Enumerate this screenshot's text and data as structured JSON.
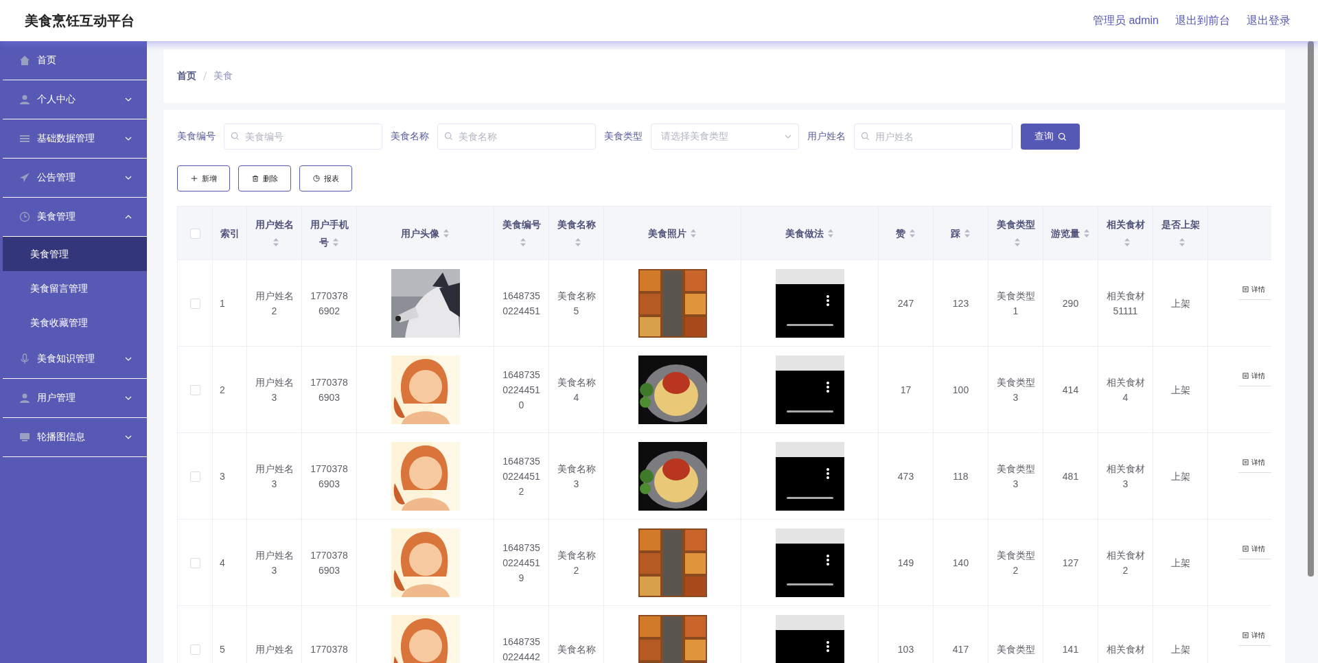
{
  "header": {
    "title": "美食烹饪互动平台",
    "links": [
      "管理员 admin",
      "退出到前台",
      "退出登录"
    ]
  },
  "sidebar": {
    "items": [
      {
        "label": "首页",
        "kind": "link"
      },
      {
        "label": "个人中心",
        "kind": "group",
        "expanded": false
      },
      {
        "label": "基础数据管理",
        "kind": "group",
        "expanded": false
      },
      {
        "label": "公告管理",
        "kind": "group",
        "expanded": false
      },
      {
        "label": "美食管理",
        "kind": "group",
        "expanded": true,
        "children": [
          {
            "label": "美食管理",
            "selected": true
          },
          {
            "label": "美食留言管理",
            "selected": false
          },
          {
            "label": "美食收藏管理",
            "selected": false
          }
        ]
      },
      {
        "label": "美食知识管理",
        "kind": "group",
        "expanded": false
      },
      {
        "label": "用户管理",
        "kind": "group",
        "expanded": false
      },
      {
        "label": "轮播图信息",
        "kind": "group",
        "expanded": false
      }
    ]
  },
  "breadcrumb": [
    "首页",
    "美食"
  ],
  "filters": [
    {
      "label": "美食编号",
      "placeholder": "美食编号",
      "kind": "input"
    },
    {
      "label": "美食名称",
      "placeholder": "美食名称",
      "kind": "input"
    },
    {
      "label": "美食类型",
      "placeholder": "请选择美食类型",
      "kind": "select"
    },
    {
      "label": "用户姓名",
      "placeholder": "用户姓名",
      "kind": "input"
    }
  ],
  "search_button": "查询",
  "actions": [
    "新增",
    "删除",
    "报表"
  ],
  "table": {
    "header_checked": false,
    "columns": [
      {
        "label": "索引",
        "sortable": false
      },
      {
        "label": "用户姓名",
        "sortable": true
      },
      {
        "label": "用户手机号",
        "sortable": true
      },
      {
        "label": "用户头像",
        "sortable": true
      },
      {
        "label": "美食编号",
        "sortable": true
      },
      {
        "label": "美食名称",
        "sortable": true
      },
      {
        "label": "美食照片",
        "sortable": true
      },
      {
        "label": "美食做法",
        "sortable": true
      },
      {
        "label": "赞",
        "sortable": true
      },
      {
        "label": "踩",
        "sortable": true
      },
      {
        "label": "美食类型",
        "sortable": true
      },
      {
        "label": "游览量",
        "sortable": true
      },
      {
        "label": "相关食材",
        "sortable": true
      },
      {
        "label": "是否上架",
        "sortable": true
      }
    ],
    "rows": [
      {
        "checked": false,
        "cells": [
          "1",
          "用户姓名2",
          "17703786902",
          {
            "kind": "picture"
          },
          "16487350224451",
          "美食名称5",
          {
            "kind": "picture"
          },
          {
            "kind": "picture"
          },
          "247",
          "123",
          "美食类型1",
          "290",
          "相关食材51111",
          "上架"
        ],
        "action": "详情"
      },
      {
        "checked": false,
        "cells": [
          "2",
          "用户姓名3",
          "17703786903",
          {
            "kind": "picture"
          },
          "164873502244510",
          "美食名称4",
          {
            "kind": "picture"
          },
          {
            "kind": "picture"
          },
          "17",
          "100",
          "美食类型3",
          "414",
          "相关食材4",
          "上架"
        ],
        "action": "详情"
      },
      {
        "checked": false,
        "cells": [
          "3",
          "用户姓名3",
          "17703786903",
          {
            "kind": "picture"
          },
          "164873502244512",
          "美食名称3",
          {
            "kind": "picture"
          },
          {
            "kind": "picture"
          },
          "473",
          "118",
          "美食类型3",
          "481",
          "相关食材3",
          "上架"
        ],
        "action": "详情"
      },
      {
        "checked": false,
        "cells": [
          "4",
          "用户姓名3",
          "17703786903",
          {
            "kind": "picture"
          },
          "164873502244519",
          "美食名称2",
          {
            "kind": "picture"
          },
          {
            "kind": "picture"
          },
          "149",
          "140",
          "美食类型2",
          "127",
          "相关食材2",
          "上架"
        ],
        "action": "详情"
      },
      {
        "checked": false,
        "cells": [
          "5",
          "用户姓名",
          "1770378",
          {
            "kind": "picture"
          },
          "16487350224442",
          "美食名称",
          {
            "kind": "picture"
          },
          {
            "kind": "picture"
          },
          "103",
          "417",
          "美食类型",
          "141",
          "相关食材",
          "上架"
        ],
        "action": "详情"
      }
    ]
  }
}
